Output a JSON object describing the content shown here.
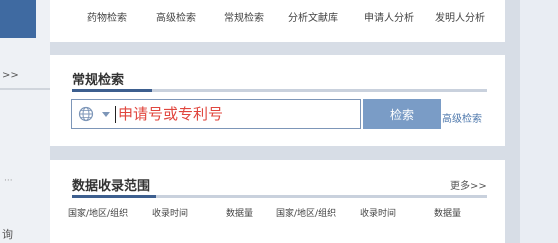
{
  "nav": {
    "links": [
      "药物检索",
      "高级检索",
      "常规检索",
      "分析文献库",
      "申请人分析",
      "发明人分析"
    ]
  },
  "sidebar": {
    "arrows": ">>",
    "dots": "···",
    "fragment": "询"
  },
  "search": {
    "title": "常规检索",
    "placeholder": "申请号或专利号",
    "button_label": "检索",
    "advanced_link": "高级检索"
  },
  "data_scope": {
    "title": "数据收录范围",
    "more_link": "更多>>",
    "columns": [
      "国家/地区/组织",
      "收录时间",
      "数据量",
      "国家/地区/组织",
      "收录时间",
      "数据量"
    ]
  },
  "colors": {
    "accent": "#3d5f8f",
    "button": "#7a9cc6",
    "placeholder": "#e0463e",
    "link": "#4f79ad"
  }
}
